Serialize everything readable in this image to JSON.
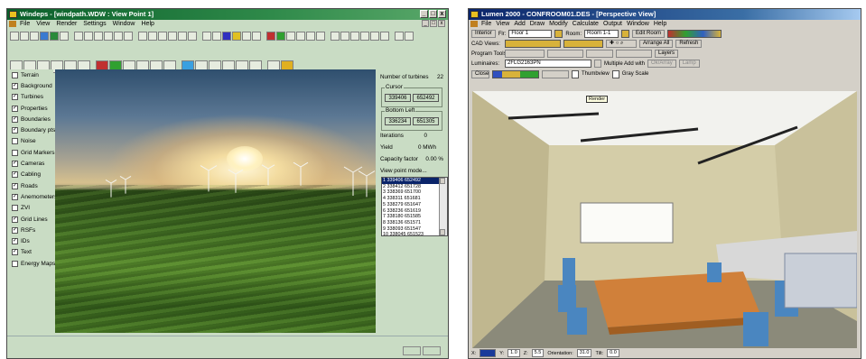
{
  "left_window": {
    "title": "Windeps - [windpath.WDW : View Point 1]",
    "menu": [
      "File",
      "View",
      "Render",
      "Settings",
      "Window",
      "Help"
    ],
    "layers": [
      {
        "label": "Terrain",
        "checked": false
      },
      {
        "label": "Background",
        "checked": true
      },
      {
        "label": "Turbines",
        "checked": true
      },
      {
        "label": "Properties",
        "checked": true
      },
      {
        "label": "Boundaries",
        "checked": true
      },
      {
        "label": "Boundary pts",
        "checked": true
      },
      {
        "label": "Noise",
        "checked": false
      },
      {
        "label": "Grid Markers",
        "checked": false
      },
      {
        "label": "Cameras",
        "checked": true
      },
      {
        "label": "Cabling",
        "checked": true
      },
      {
        "label": "Roads",
        "checked": true
      },
      {
        "label": "Anemometers",
        "checked": true
      },
      {
        "label": "ZVI",
        "checked": false
      },
      {
        "label": "Grid Lines",
        "checked": true
      },
      {
        "label": "RSFs",
        "checked": true
      },
      {
        "label": "IDs",
        "checked": true
      },
      {
        "label": "Text",
        "checked": true
      },
      {
        "label": "Energy Maps",
        "checked": false
      }
    ],
    "info": {
      "turbines_label": "Number of turbines",
      "turbines_value": "22",
      "cursor_label": "Cursor",
      "cursor_x": "339406",
      "cursor_y": "652492",
      "bottomleft_label": "Bottom Left",
      "bl_x": "336234",
      "bl_y": "651305",
      "iterations_label": "Iterations",
      "iterations_value": "0",
      "yield_label": "Yield",
      "yield_value": "0 MWh",
      "capacity_label": "Capacity factor",
      "capacity_value": "0.00 %",
      "viewpoint_label": "View point mode..."
    },
    "viewpoints": [
      "1 339406 652492",
      "2 338412 651728",
      "3 338369 651700",
      "4 338311 651681",
      "5 338279 651647",
      "6 338236 651619",
      "7 338180 651585",
      "8 338136 651571",
      "9 338093 651547",
      "10 338045 651523"
    ]
  },
  "right_window": {
    "title": "Lumen 2000 - CONFROOM01.DES - [Perspective View]",
    "menu": [
      "File",
      "View",
      "Add",
      "Draw",
      "Modify",
      "Calculate",
      "Output",
      "Window",
      "Help"
    ],
    "row1": {
      "interior": "Interior",
      "flr_label": "Flr:",
      "floor": "Floor 1",
      "room_label": "Room:",
      "room": "Room 1-1",
      "edit_room": "Edit Room"
    },
    "row2": {
      "cad_label": "CAD Views:",
      "arrange": "Arrange All",
      "refresh": "Refresh"
    },
    "row3": {
      "program_label": "Program Tools:",
      "layers": "Layers"
    },
    "row4": {
      "lum_label": "Luminaires:",
      "lum_value": "2FLG2163PN",
      "multiple": "Multiple Add with",
      "btn_a": "Ok/Array",
      "btn_b": "Lamp"
    },
    "row5": {
      "close": "Close",
      "thumbview": "Thumbview",
      "grayscale": "Gray Scale"
    },
    "tooltip": "Render",
    "status": {
      "x_label": "X:",
      "x": "",
      "y_label": "Y:",
      "y": "1.0",
      "z_label": "Z:",
      "z": "5.5",
      "orient_label": "Orientation:",
      "orient": "31.0",
      "tilt_label": "Tilt:",
      "tilt": "0.0"
    }
  }
}
